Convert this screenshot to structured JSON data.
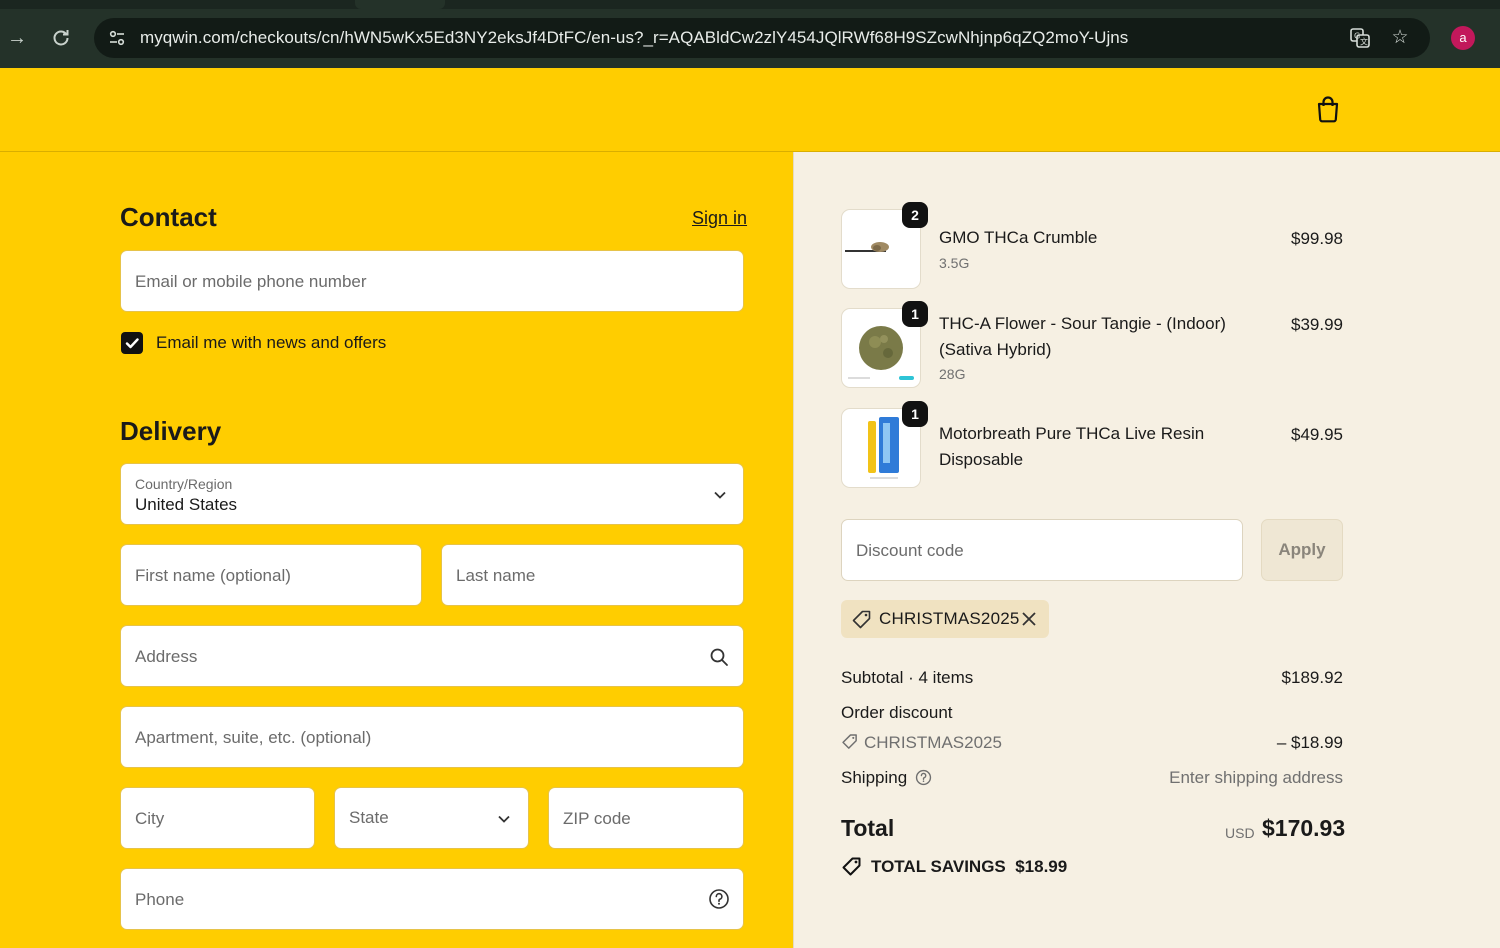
{
  "browser": {
    "url": "myqwin.com/checkouts/cn/hWN5wKx5Ed3NY2eksJf4DtFC/en-us?_r=AQABldCw2zlY454JQlRWf68H9SZcwNhjnp6qZQ2moY-Ujns",
    "avatar_letter": "a",
    "avatar_color": "#c2185b"
  },
  "theme": {
    "accent": "#ffcd00",
    "summary_bg": "#f6f0e3"
  },
  "contact": {
    "title": "Contact",
    "sign_in": "Sign in",
    "email_placeholder": "Email or mobile phone number",
    "newsletter_label": "Email me with news and offers",
    "newsletter_checked": true
  },
  "delivery": {
    "title": "Delivery",
    "country_label": "Country/Region",
    "country_value": "United States",
    "first_name_placeholder": "First name (optional)",
    "last_name_placeholder": "Last name",
    "address_placeholder": "Address",
    "apartment_placeholder": "Apartment, suite, etc. (optional)",
    "city_placeholder": "City",
    "state_placeholder": "State",
    "zip_placeholder": "ZIP code",
    "phone_placeholder": "Phone"
  },
  "cart": {
    "items": [
      {
        "qty": "2",
        "name": "GMO THCa Crumble",
        "variant": "3.5G",
        "price": "$99.98"
      },
      {
        "qty": "1",
        "name": "THC-A Flower - Sour Tangie - (Indoor) (Sativa Hybrid)",
        "variant": "28G",
        "price": "$39.99"
      },
      {
        "qty": "1",
        "name": "Motorbreath Pure THCa Live Resin Disposable",
        "variant": "",
        "price": "$49.95"
      }
    ],
    "discount_placeholder": "Discount code",
    "apply_label": "Apply",
    "applied_code": "CHRISTMAS2025"
  },
  "summary": {
    "subtotal_label": "Subtotal · 4 items",
    "subtotal_value": "$189.92",
    "order_discount_label": "Order discount",
    "discount_code": "CHRISTMAS2025",
    "discount_value": "– $18.99",
    "shipping_label": "Shipping",
    "shipping_value": "Enter shipping address",
    "total_label": "Total",
    "currency": "USD",
    "total_value": "$170.93",
    "savings_label": "TOTAL SAVINGS",
    "savings_value": "$18.99"
  }
}
